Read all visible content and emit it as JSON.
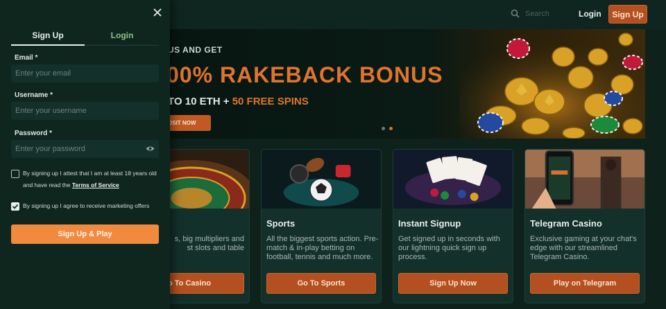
{
  "header": {
    "search_placeholder": "Search",
    "login_label": "Login",
    "signup_label": "Sign Up"
  },
  "hero": {
    "pre_title": "US AND GET",
    "title": "00% RAKEBACK BONUS",
    "sub_prefix": "TO 10 ETH + ",
    "sub_accent": "50 FREE SPINS",
    "button_label": "OSIT NOW",
    "slide_dots": 2,
    "active_slide": 2
  },
  "cards": [
    {
      "title": "",
      "desc": "s, big multipliers and\nst slots and table",
      "button": "o To Casino"
    },
    {
      "title": "Sports",
      "desc": "All the biggest sports action. Pre-match & in-play betting on football, tennis and much more.",
      "button": "Go To Sports"
    },
    {
      "title": "Instant Signup",
      "desc": "Get signed up in seconds with our lightning quick sign up process.",
      "button": "Sign Up Now"
    },
    {
      "title": "Telegram Casino",
      "desc": "Exclusive gaming at your chat's edge with our streamlined Telegram Casino.",
      "button": "Play on Telegram"
    }
  ],
  "signup_panel": {
    "tabs": [
      "Sign Up",
      "Login"
    ],
    "active_tab": "Sign Up",
    "email_label": "Email *",
    "email_placeholder": "Enter your email",
    "username_label": "Username *",
    "username_placeholder": "Enter your username",
    "password_label": "Password *",
    "password_placeholder": "Enter your password",
    "age_consent_text": "By signing up I attest that I am at least 18 years old and have read the ",
    "terms_link": "Terms of Service",
    "age_consent_checked": false,
    "marketing_text": "By signing up I agree to receive marketing offers",
    "marketing_checked": true,
    "submit_label": "Sign Up & Play"
  },
  "colors": {
    "accent": "#f28a3e",
    "button": "#b4501f",
    "background": "#0e211b",
    "panel": "#0f261f",
    "tab_inactive": "#8fc28b"
  },
  "icons": [
    "close-icon",
    "search-icon",
    "eye-icon",
    "checkmark-icon"
  ]
}
